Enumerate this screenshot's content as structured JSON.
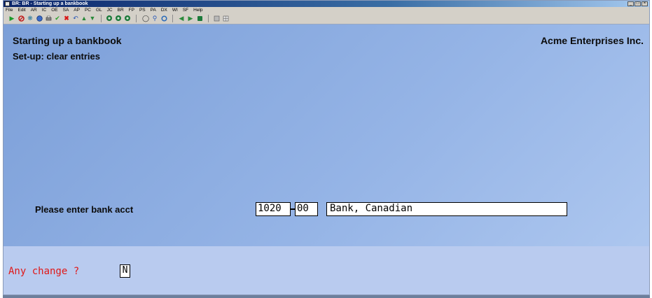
{
  "window": {
    "title": "BR: BR - Starting up a bankbook",
    "controls": [
      "_",
      "□",
      "×"
    ]
  },
  "menu": [
    "File",
    "Edit",
    "AR",
    "IC",
    "OE",
    "SA",
    "AP",
    "PC",
    "GL",
    "JC",
    "BR",
    "FP",
    "PS",
    "PA",
    "DX",
    "WI",
    "SF",
    "Help"
  ],
  "toolbar_icons": [
    "green-arrow-icon",
    "stop-icon",
    "settings-icon",
    "globe-icon",
    "printer-icon",
    "check-icon",
    "cancel-icon",
    "undo-icon",
    "arrow-up-icon",
    "arrow-down-icon",
    "record-icon",
    "record-icon",
    "record-icon",
    "binoculars-icon",
    "magnify-icon",
    "refresh-icon",
    "prev-icon",
    "next-icon",
    "stop-square-icon",
    "calculator-icon",
    "grid-icon"
  ],
  "screen": {
    "title": "Starting up a bankbook",
    "company": "Acme Enterprises Inc.",
    "subtitle": "Set-up: clear entries",
    "bank_prompt": "Please enter bank acct",
    "acct_main": "1020",
    "acct_sub": "00",
    "acct_name": "Bank, Canadian",
    "change_prompt": "Any change ?",
    "change_value": "N"
  },
  "colors": {
    "background": "#95b4e6",
    "lower_band": "#b9cbef",
    "prompt_red": "#e01818",
    "titlebar": "#0a246a"
  }
}
